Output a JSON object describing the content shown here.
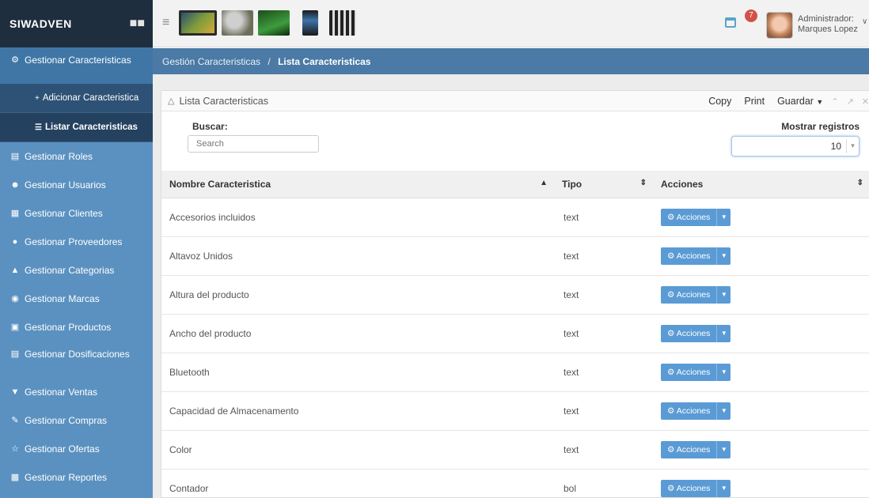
{
  "brand": {
    "name": "SIWADVEN",
    "icon": "robot-icon"
  },
  "sidebar": {
    "items": [
      {
        "name": "sidebar-item-caracteristicas",
        "label": "Gestionar Caracteristicas",
        "icon": "cogs-icon",
        "active": true
      },
      {
        "name": "sidebar-item-roles",
        "label": "Gestionar Roles",
        "icon": "list-icon"
      },
      {
        "name": "sidebar-item-usuarios",
        "label": "Gestionar Usuarios",
        "icon": "users-icon"
      },
      {
        "name": "sidebar-item-clientes",
        "label": "Gestionar Clientes",
        "icon": "building-icon"
      },
      {
        "name": "sidebar-item-proveedores",
        "label": "Gestionar Proveedores",
        "icon": "car-icon"
      },
      {
        "name": "sidebar-item-categorias",
        "label": "Gestionar Categorias",
        "icon": "sitemap-icon"
      },
      {
        "name": "sidebar-item-marcas",
        "label": "Gestionar Marcas",
        "icon": "ok-circle-icon"
      },
      {
        "name": "sidebar-item-productos",
        "label": "Gestionar Productos",
        "icon": "box-icon"
      },
      {
        "name": "sidebar-item-dosificaciones",
        "label": "Gestionar Dosificaciones",
        "icon": "file-icon"
      },
      {
        "name": "sidebar-item-ventas",
        "label": "Gestionar Ventas",
        "icon": "cart-icon"
      },
      {
        "name": "sidebar-item-compras",
        "label": "Gestionar Compras",
        "icon": "pencil-icon"
      },
      {
        "name": "sidebar-item-ofertas",
        "label": "Gestionar Ofertas",
        "icon": "star-icon"
      },
      {
        "name": "sidebar-item-reportes",
        "label": "Gestionar Reportes",
        "icon": "chart-icon"
      }
    ],
    "sub": [
      {
        "label": "Adicionar Caracteristica",
        "icon": "plus-icon"
      },
      {
        "label": "Listar Caracteristicas",
        "icon": "list-icon"
      }
    ]
  },
  "topbar": {
    "notifications": "7",
    "user_role": "Administrador:",
    "user_name": "Marques Lopez"
  },
  "breadcrumb": {
    "parent": "Gestión Caracteristicas",
    "separator": "/",
    "current": "Lista Caracteristicas"
  },
  "widget": {
    "title": "Lista Caracteristicas",
    "tools": {
      "copy": "Copy",
      "print": "Print",
      "save": "Guardar"
    },
    "search_label": "Buscar:",
    "search_placeholder": "Search",
    "show_label": "Mostrar registros",
    "show_value": "10"
  },
  "table": {
    "headers": [
      "Nombre Caracteristica",
      "Tipo",
      "Acciones"
    ],
    "action_label": "Acciones",
    "rows": [
      {
        "nombre": "Accesorios incluidos",
        "tipo": "text"
      },
      {
        "nombre": "Altavoz Unidos",
        "tipo": "text"
      },
      {
        "nombre": "Altura del producto",
        "tipo": "text"
      },
      {
        "nombre": "Ancho del producto",
        "tipo": "text"
      },
      {
        "nombre": "Bluetooth",
        "tipo": "text"
      },
      {
        "nombre": "Capacidad de Almacenamento",
        "tipo": "text"
      },
      {
        "nombre": "Color",
        "tipo": "text"
      },
      {
        "nombre": "Contador",
        "tipo": "bol"
      }
    ]
  },
  "colors": {
    "sidebar": "#5b91c0",
    "brand_bg": "#1e2e3e",
    "breadcrumb": "#4a7aa5",
    "button": "#5b9bd5"
  }
}
